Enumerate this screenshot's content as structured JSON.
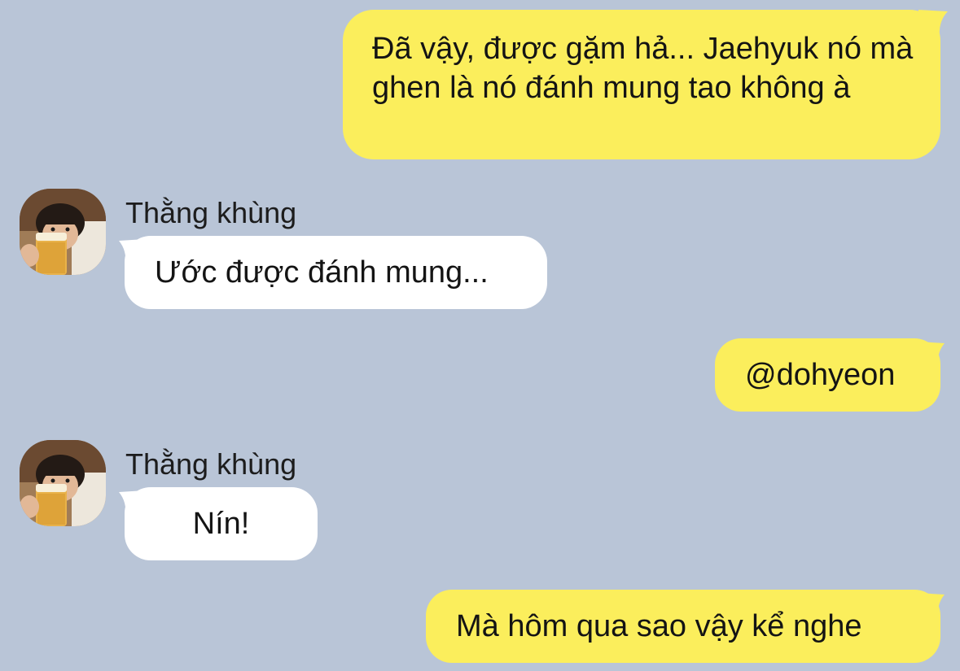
{
  "colors": {
    "background": "#b9c5d7",
    "sent_bubble": "#fbee5c",
    "received_bubble": "#ffffff",
    "text": "#141414"
  },
  "messages": [
    {
      "direction": "sent",
      "text": "Đã vậy, được gặm hả... Jaehyuk nó mà ghen là nó đánh mung tao không à"
    },
    {
      "direction": "received",
      "sender": "Thằng khùng",
      "avatar": "avatar-photo",
      "text": "Ước được đánh mung..."
    },
    {
      "direction": "sent",
      "text": "@dohyeon"
    },
    {
      "direction": "received",
      "sender": "Thằng khùng",
      "avatar": "avatar-photo",
      "text": "Nín!"
    },
    {
      "direction": "sent",
      "text": "Mà hôm qua sao vậy kể nghe"
    }
  ]
}
